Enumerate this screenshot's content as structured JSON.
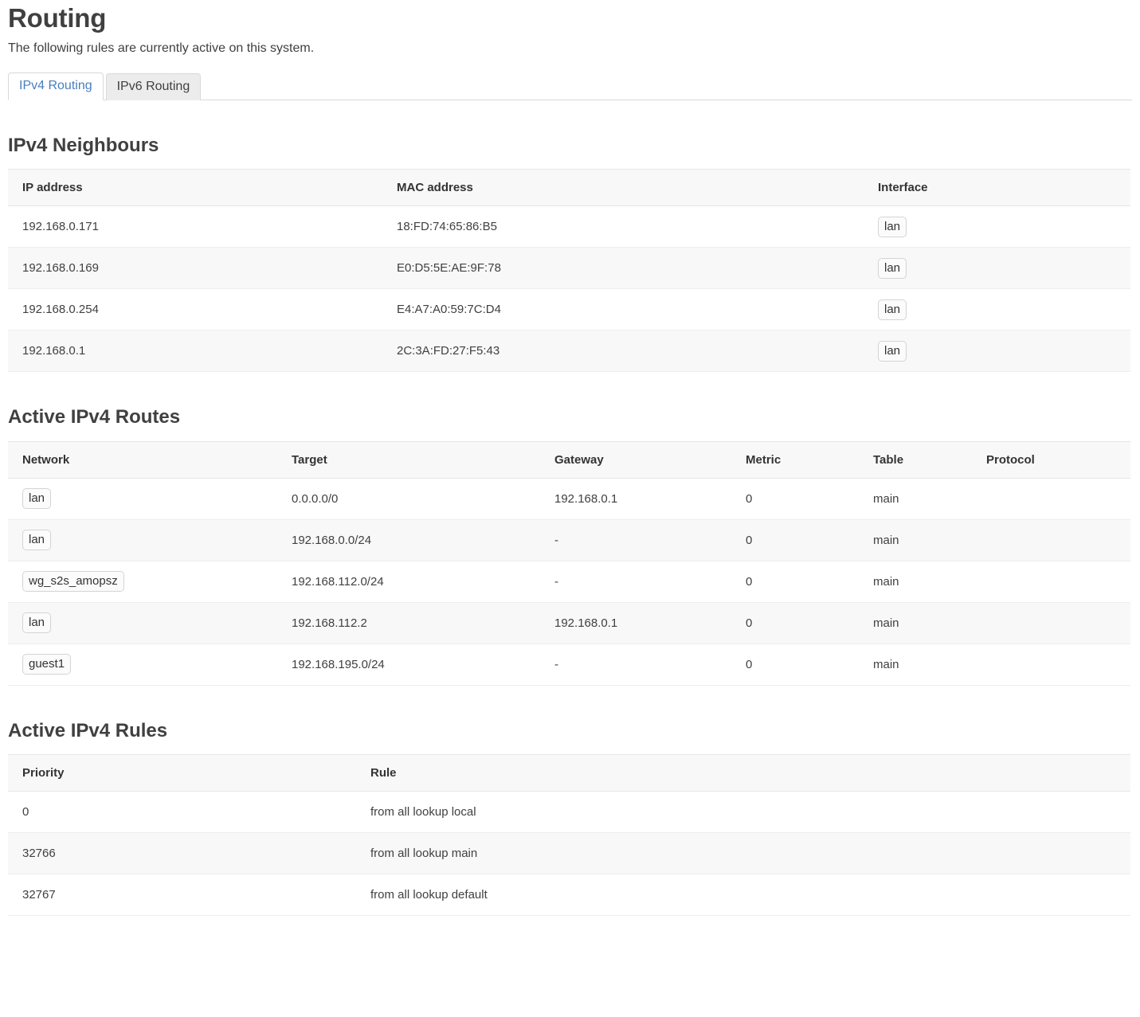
{
  "header": {
    "title": "Routing",
    "subtitle": "The following rules are currently active on this system."
  },
  "tabs": [
    {
      "label": "IPv4 Routing",
      "active": true
    },
    {
      "label": "IPv6 Routing",
      "active": false
    }
  ],
  "neighbours": {
    "heading": "IPv4 Neighbours",
    "columns": [
      "IP address",
      "MAC address",
      "Interface"
    ],
    "rows": [
      {
        "ip": "192.168.0.171",
        "mac": "18:FD:74:65:86:B5",
        "interface": "lan"
      },
      {
        "ip": "192.168.0.169",
        "mac": "E0:D5:5E:AE:9F:78",
        "interface": "lan"
      },
      {
        "ip": "192.168.0.254",
        "mac": "E4:A7:A0:59:7C:D4",
        "interface": "lan"
      },
      {
        "ip": "192.168.0.1",
        "mac": "2C:3A:FD:27:F5:43",
        "interface": "lan"
      }
    ]
  },
  "routes": {
    "heading": "Active IPv4 Routes",
    "columns": [
      "Network",
      "Target",
      "Gateway",
      "Metric",
      "Table",
      "Protocol"
    ],
    "rows": [
      {
        "network": "lan",
        "target": "0.0.0.0/0",
        "gateway": "192.168.0.1",
        "metric": "0",
        "table": "main",
        "protocol": ""
      },
      {
        "network": "lan",
        "target": "192.168.0.0/24",
        "gateway": "-",
        "metric": "0",
        "table": "main",
        "protocol": ""
      },
      {
        "network": "wg_s2s_amopsz",
        "target": "192.168.112.0/24",
        "gateway": "-",
        "metric": "0",
        "table": "main",
        "protocol": ""
      },
      {
        "network": "lan",
        "target": "192.168.112.2",
        "gateway": "192.168.0.1",
        "metric": "0",
        "table": "main",
        "protocol": ""
      },
      {
        "network": "guest1",
        "target": "192.168.195.0/24",
        "gateway": "-",
        "metric": "0",
        "table": "main",
        "protocol": ""
      }
    ]
  },
  "rules": {
    "heading": "Active IPv4 Rules",
    "columns": [
      "Priority",
      "Rule"
    ],
    "rows": [
      {
        "priority": "0",
        "rule": "from all lookup local"
      },
      {
        "priority": "32766",
        "rule": "from all lookup main"
      },
      {
        "priority": "32767",
        "rule": "from all lookup default"
      }
    ]
  },
  "colors": {
    "accent": "#4a7ebb",
    "text": "#404040",
    "table_header_bg": "#f8f8f8",
    "stripe_bg": "#f8f8f8",
    "border": "#e6e6e6"
  }
}
